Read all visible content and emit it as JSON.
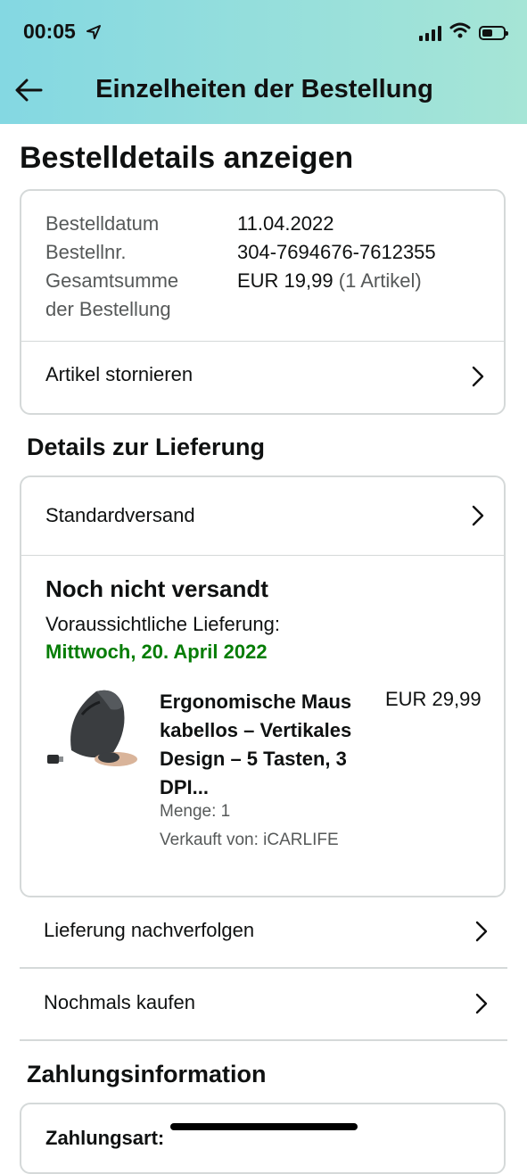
{
  "status_bar": {
    "time": "00:05"
  },
  "nav": {
    "title": "Einzelheiten der Bestellung"
  },
  "page": {
    "title": "Bestelldetails anzeigen"
  },
  "summary": {
    "date_label": "Bestelldatum",
    "date_value": "11.04.2022",
    "number_label": "Bestellnr.",
    "number_value": "304-7694676-7612355",
    "total_label_1": "Gesamtsumme",
    "total_label_2": "der Bestellung",
    "total_value": "EUR 19,99",
    "total_items": "(1 Artikel)",
    "cancel_label": "Artikel stornieren"
  },
  "delivery": {
    "section_title": "Details zur Lieferung",
    "method": "Standardversand",
    "status": "Noch nicht versandt",
    "expected_label": "Voraussichtliche Lieferung:",
    "expected_date": "Mittwoch, 20. April 2022",
    "product": {
      "name": "Ergonomische Maus kabellos – Vertikales Design – 5 Tasten, 3 DPI...",
      "price": "EUR 29,99",
      "quantity": "Menge: 1",
      "seller": "Verkauft von: iCARLIFE"
    }
  },
  "actions": {
    "track": "Lieferung nachverfolgen",
    "buy_again": "Nochmals kaufen"
  },
  "payment": {
    "section_title": "Zahlungsinformation",
    "method_label": "Zahlungsart:"
  },
  "colors": {
    "header_start": "#84d8e2",
    "header_end": "#a6e5d6",
    "delivery_date": "#067d06",
    "border": "#d5d9d9"
  },
  "icons": [
    "back-arrow-icon",
    "location-arrow-icon",
    "signal-icon",
    "wifi-icon",
    "battery-icon",
    "chevron-right-icon"
  ]
}
